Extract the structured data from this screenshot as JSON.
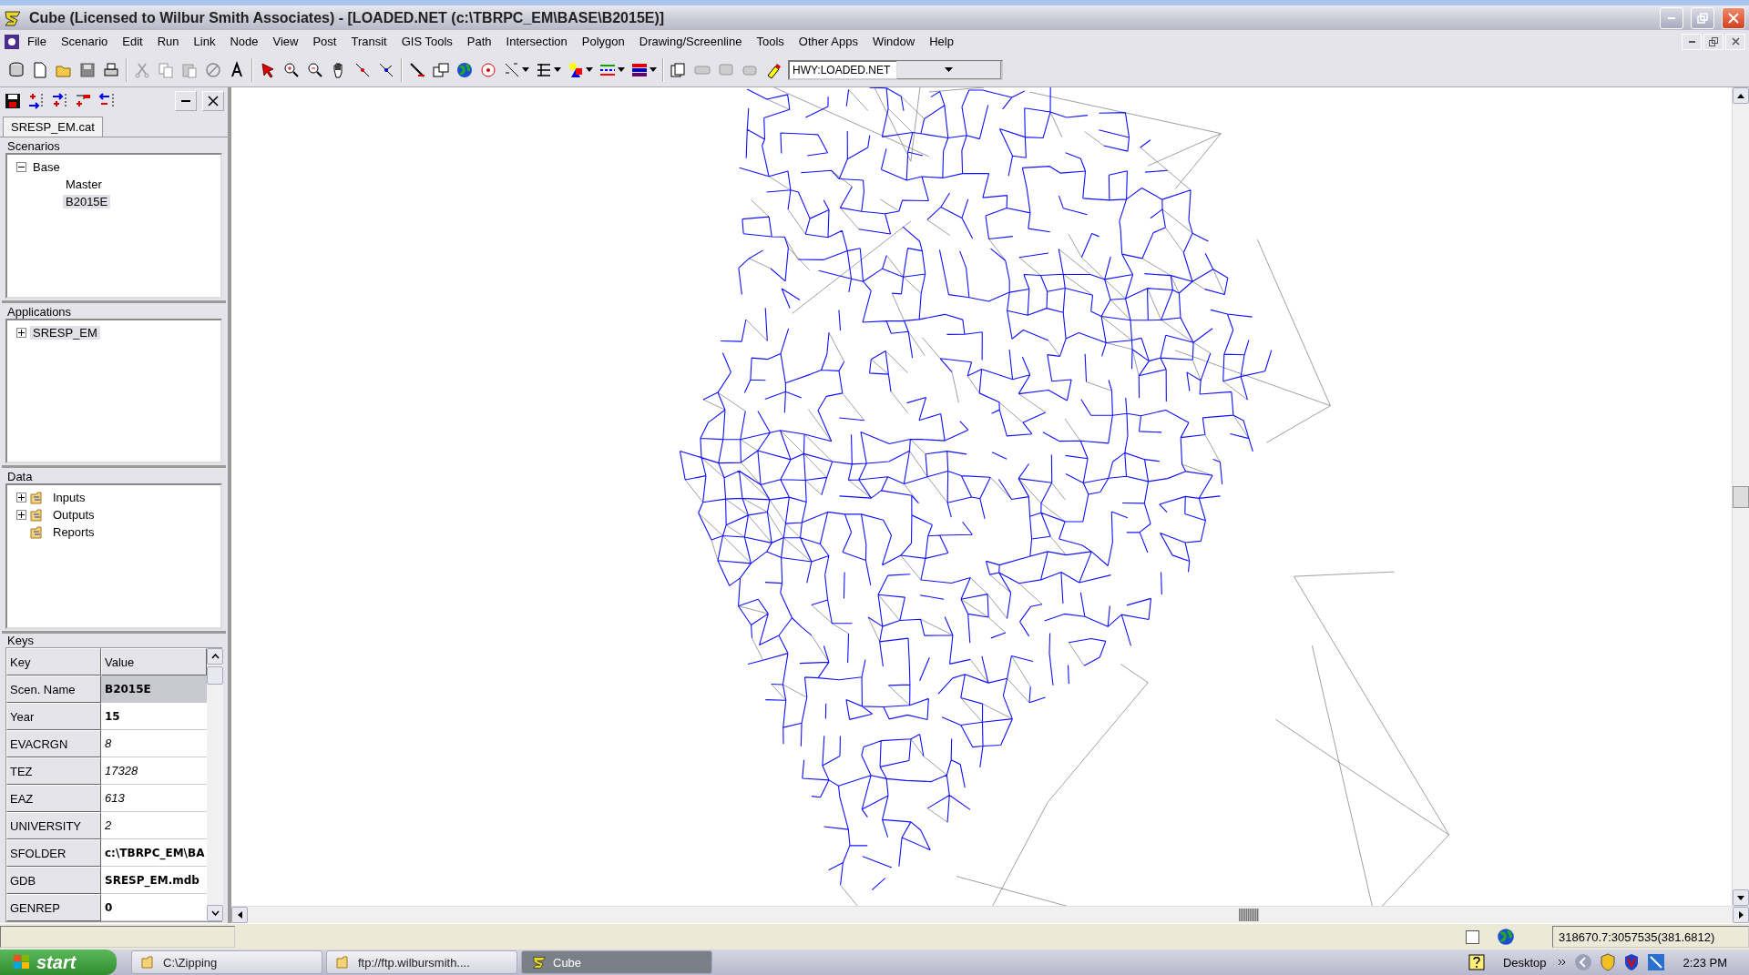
{
  "window": {
    "title": "Cube (Licensed to Wilbur Smith Associates) - [LOADED.NET (c:\\TBRPC_EM\\BASE\\B2015E)]"
  },
  "menu": [
    "File",
    "Scenario",
    "Edit",
    "Run",
    "Link",
    "Node",
    "View",
    "Post",
    "Transit",
    "GIS Tools",
    "Path",
    "Intersection",
    "Polygon",
    "Drawing/Screenline",
    "Tools",
    "Other Apps",
    "Window",
    "Help"
  ],
  "toolbar": {
    "layer_select": "HWY:LOADED.NET"
  },
  "catalog": {
    "tab": "SRESP_EM.cat",
    "sections": [
      {
        "title": "Scenarios",
        "items": [
          {
            "label": "Base",
            "expanded": true,
            "selected": false,
            "children": [
              {
                "label": "Master",
                "selected": false
              },
              {
                "label": "B2015E",
                "selected": true
              }
            ]
          }
        ]
      },
      {
        "title": "Applications",
        "items": [
          {
            "label": "SRESP_EM",
            "expanded": false,
            "selected": true
          }
        ]
      },
      {
        "title": "Data",
        "items": [
          {
            "label": "Inputs",
            "expanded": false,
            "selected": false,
            "kind": "folder"
          },
          {
            "label": "Outputs",
            "expanded": false,
            "selected": false,
            "kind": "folder"
          },
          {
            "label": "Reports",
            "selected": false,
            "kind": "folder"
          }
        ]
      }
    ],
    "keys": {
      "title": "Keys",
      "columns": [
        "Key",
        "Value"
      ],
      "rows": [
        {
          "key": "Scen. Name",
          "value": "B2015E",
          "kind": "bold",
          "selected": true
        },
        {
          "key": "Year",
          "value": "15",
          "kind": "bold",
          "selected": false
        },
        {
          "key": "EVACRGN",
          "value": "8",
          "kind": "italic",
          "selected": false
        },
        {
          "key": "TEZ",
          "value": "17328",
          "kind": "italic",
          "selected": false
        },
        {
          "key": "EAZ",
          "value": "613",
          "kind": "italic",
          "selected": false
        },
        {
          "key": "UNIVERSITY",
          "value": "2",
          "kind": "italic",
          "selected": false
        },
        {
          "key": "SFOLDER",
          "value": "c:\\TBRPC_EM\\BA",
          "kind": "bold",
          "selected": false
        },
        {
          "key": "GDB",
          "value": "SRESP_EM.mdb",
          "kind": "bold",
          "selected": false
        },
        {
          "key": "GENREP",
          "value": "0",
          "kind": "bold",
          "selected": false
        }
      ]
    }
  },
  "status_bar": {
    "checked": false,
    "coordinates": "318670.7:3057535(381.6812)"
  },
  "taskbar": {
    "start": "start",
    "tasks": [
      {
        "label": "C:\\Zipping",
        "kind": "folder",
        "selected": false
      },
      {
        "label": "ftp://ftp.wilbursmith....",
        "kind": "folder",
        "selected": false
      },
      {
        "label": "Cube",
        "kind": "app",
        "selected": true
      }
    ],
    "desktop": "Desktop",
    "clock": "2:23 PM"
  }
}
